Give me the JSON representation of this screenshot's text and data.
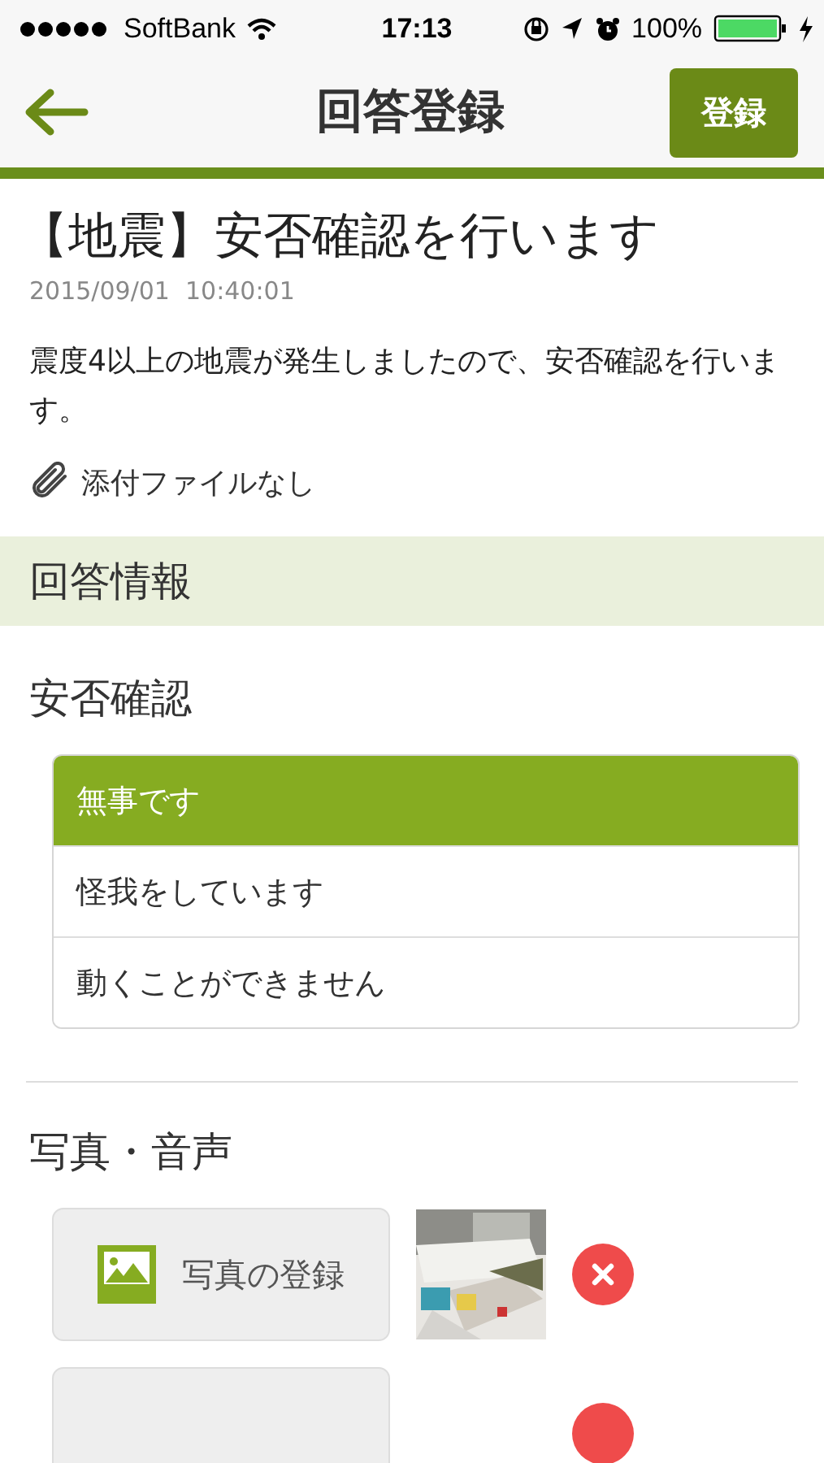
{
  "status_bar": {
    "carrier": "SoftBank",
    "time": "17:13",
    "battery": "100%"
  },
  "nav": {
    "title": "回答登録",
    "action": "登録"
  },
  "message": {
    "title": "【地震】安否確認を行います",
    "date": "2015/09/01  10:40:01",
    "body": "震度4以上の地震が発生しましたので、安否確認を行います。",
    "attachment": "添付ファイルなし"
  },
  "section": {
    "title": "回答情報"
  },
  "safety": {
    "label": "安否確認",
    "options": [
      {
        "label": "無事です",
        "selected": true
      },
      {
        "label": "怪我をしています",
        "selected": false
      },
      {
        "label": "動くことができません",
        "selected": false
      }
    ]
  },
  "media": {
    "label": "写真・音声",
    "items": [
      {
        "label": "写真の登録"
      },
      {
        "kind": "blank"
      }
    ]
  }
}
